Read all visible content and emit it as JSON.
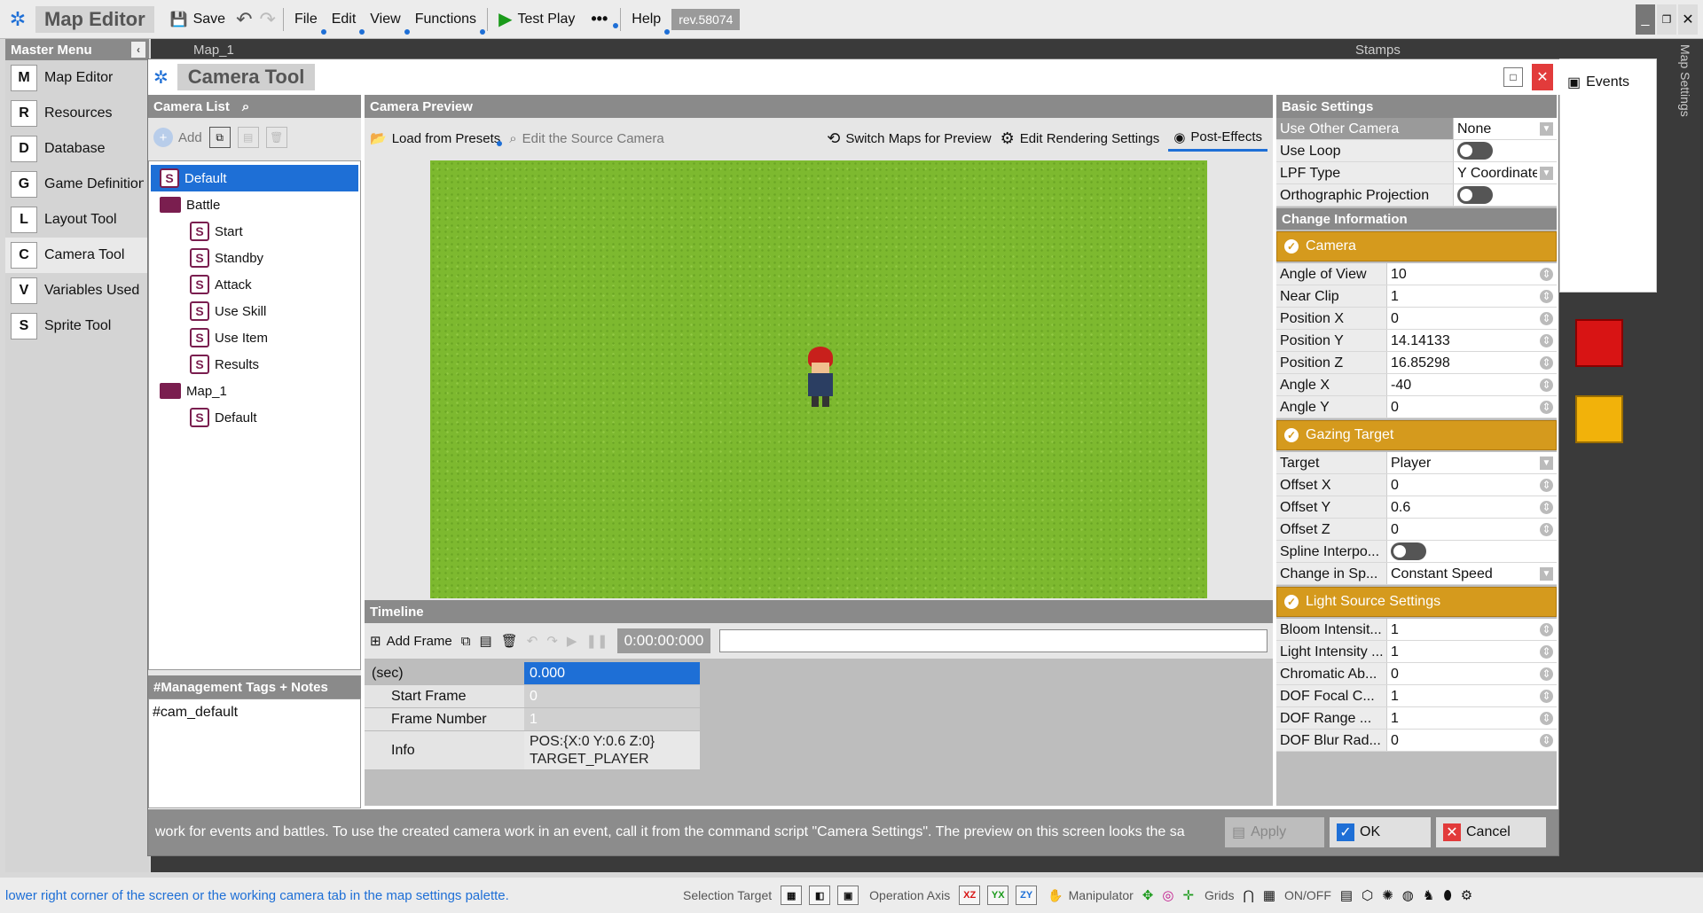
{
  "topbar": {
    "app_title": "Map Editor",
    "save": "Save",
    "menus": [
      "File",
      "Edit",
      "View",
      "Functions"
    ],
    "test_play": "Test Play",
    "help": "Help",
    "revision": "rev.58074"
  },
  "master": {
    "title": "Master Menu",
    "items": [
      {
        "label": "Map Editor",
        "glyph": "M"
      },
      {
        "label": "Resources",
        "glyph": "R"
      },
      {
        "label": "Database",
        "glyph": "D"
      },
      {
        "label": "Game Definition",
        "glyph": "G"
      },
      {
        "label": "Layout Tool",
        "glyph": "L"
      },
      {
        "label": "Camera Tool",
        "glyph": "C"
      },
      {
        "label": "Variables Used",
        "glyph": "V"
      },
      {
        "label": "Sprite Tool",
        "glyph": "S"
      }
    ]
  },
  "bg": {
    "map_tab": "Map_1",
    "stamps": "Stamps",
    "events": "Events",
    "map_settings": "Map Settings"
  },
  "dialog": {
    "title": "Camera Tool",
    "camera_list_title": "Camera List",
    "add": "Add",
    "tree": {
      "default": "Default",
      "battle": "Battle",
      "battle_children": [
        "Start",
        "Standby",
        "Attack",
        "Use Skill",
        "Use Item",
        "Results"
      ],
      "map": "Map_1",
      "map_children": [
        "Default"
      ]
    },
    "tags_title": "#Management Tags + Notes",
    "tags_value": "#cam_default",
    "preview_title": "Camera Preview",
    "load_presets": "Load from Presets",
    "edit_source": "Edit the Source Camera",
    "switch_maps": "Switch Maps for Preview",
    "edit_rendering": "Edit Rendering Settings",
    "post_effects": "Post-Effects",
    "timeline_title": "Timeline",
    "add_frame": "Add Frame",
    "time_display": "0:00:00:000",
    "tl_sec_label": "(sec)",
    "tl_sec_value": "0.000",
    "tl_start_frame": "Start Frame",
    "tl_start_frame_value": "0",
    "tl_frame_number": "Frame Number",
    "tl_frame_number_value": "1",
    "tl_info": "Info",
    "tl_info_line1": "POS:{X:0 Y:0.6 Z:0}",
    "tl_info_line2": "TARGET_PLAYER",
    "basic_title": "Basic Settings",
    "basic": [
      {
        "k": "Use Other Camera",
        "v": "None",
        "type": "dd"
      },
      {
        "k": "Use Loop",
        "v": "",
        "type": "toggle"
      },
      {
        "k": "LPF Type",
        "v": "Y Coordinate",
        "type": "dd"
      },
      {
        "k": "Orthographic Projection",
        "v": "",
        "type": "toggle"
      }
    ],
    "change_title": "Change Information",
    "camera_section": "Camera",
    "camera_props": [
      {
        "k": "Angle of View",
        "v": "10"
      },
      {
        "k": "Near Clip",
        "v": "1"
      },
      {
        "k": "Position X",
        "v": "0"
      },
      {
        "k": "Position Y",
        "v": "14.14133"
      },
      {
        "k": "Position Z",
        "v": "16.85298"
      },
      {
        "k": "Angle X",
        "v": "-40"
      },
      {
        "k": "Angle Y",
        "v": "0"
      }
    ],
    "gazing_section": "Gazing Target",
    "gazing_props": [
      {
        "k": "Target",
        "v": "Player",
        "type": "dd"
      },
      {
        "k": "Offset X",
        "v": "0",
        "type": "spin"
      },
      {
        "k": "Offset Y",
        "v": "0.6",
        "type": "spin"
      },
      {
        "k": "Offset Z",
        "v": "0",
        "type": "spin"
      },
      {
        "k": "Spline Interpo...",
        "v": "",
        "type": "toggle"
      },
      {
        "k": "Change in Sp...",
        "v": "Constant Speed",
        "type": "dd"
      }
    ],
    "light_section": "Light Source Settings",
    "light_props": [
      {
        "k": "Bloom Intensit...",
        "v": "1"
      },
      {
        "k": "Light Intensity ...",
        "v": "1"
      },
      {
        "k": "Chromatic Ab...",
        "v": "0"
      },
      {
        "k": "DOF Focal C...",
        "v": "1"
      },
      {
        "k": "DOF Range ...",
        "v": "1"
      },
      {
        "k": "DOF Blur Rad...",
        "v": "0"
      }
    ],
    "hint": "work for events and battles.  To use the created camera work in an event, call it from the command script \"Camera Settings\".  The preview on this screen looks the sa",
    "apply": "Apply",
    "ok": "OK",
    "cancel": "Cancel"
  },
  "status": {
    "message": "lower right corner of the screen or the working camera tab in the map settings palette.",
    "selection_target": "Selection Target",
    "operation_axis": "Operation Axis",
    "axes": [
      "XZ",
      "YX",
      "ZY"
    ],
    "manipulator": "Manipulator",
    "grids": "Grids",
    "onoff": "ON/OFF"
  },
  "colors": {
    "accent": "#1e6fd6",
    "section": "#d59a1d",
    "grass": "#7db92f",
    "folder": "#7a1e4f"
  }
}
